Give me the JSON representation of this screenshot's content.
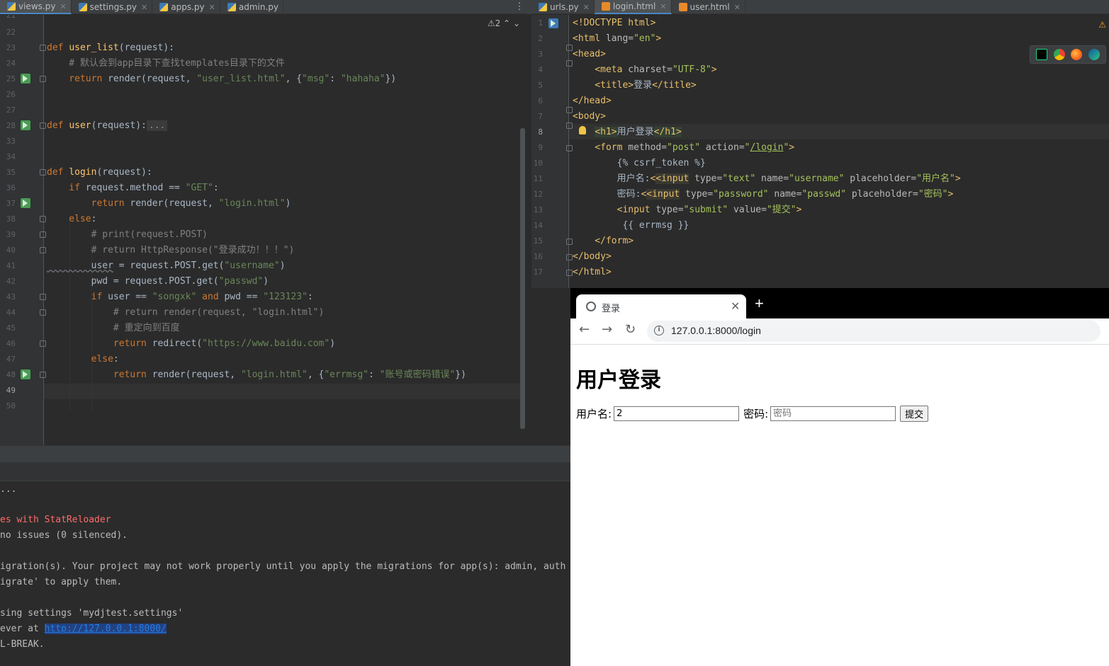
{
  "left_tabs": [
    {
      "label": "views.py",
      "active": true
    },
    {
      "label": "settings.py"
    },
    {
      "label": "apps.py"
    },
    {
      "label": "admin.py"
    }
  ],
  "right_tabs": [
    {
      "label": "urls.py"
    },
    {
      "label": "login.html",
      "active": true
    },
    {
      "label": "user.html"
    }
  ],
  "left_editor": {
    "warning_count": "2",
    "line_numbers": [
      "21",
      "22",
      "23",
      "24",
      "25",
      "26",
      "27",
      "28",
      "33",
      "34",
      "35",
      "36",
      "37",
      "38",
      "39",
      "40",
      "41",
      "42",
      "43",
      "44",
      "45",
      "46",
      "47",
      "48",
      "49",
      "50"
    ],
    "code": {
      "l23_def": "def ",
      "l23_fn": "user_list",
      "l23_rest": "(request):",
      "l24": "    # 默认会到app目录下查找templates目录下的文件",
      "l25_kw": "    return ",
      "l25_a": "render(request, ",
      "l25_s1": "\"user_list.html\"",
      "l25_b": ", {",
      "l25_s2": "\"msg\"",
      "l25_c": ": ",
      "l25_s3": "\"hahaha\"",
      "l25_d": "})",
      "l28_def": "def ",
      "l28_fn": "user",
      "l28_rest": "(request):",
      "l28_dots": "...",
      "l35_def": "def ",
      "l35_fn": "login",
      "l35_rest": "(request):",
      "l36_kw": "    if ",
      "l36_a": "request.method == ",
      "l36_s": "\"GET\"",
      "l36_b": ":",
      "l37_kw": "        return ",
      "l37_a": "render(request, ",
      "l37_s": "\"login.html\"",
      "l37_b": ")",
      "l38_kw": "    else",
      "l38_b": ":",
      "l39": "        # print(request.POST)",
      "l40": "        # return HttpResponse(\"登录成功！！！\")",
      "l41_a": "        user",
      "l41_b": " = request.POST.get(",
      "l41_s": "\"username\"",
      "l41_c": ")",
      "l42_a": "        pwd = request.POST.get(",
      "l42_s": "\"passwd\"",
      "l42_c": ")",
      "l43_kw": "        if ",
      "l43_a": "user == ",
      "l43_s1": "\"songxk\"",
      "l43_kw2": " and ",
      "l43_b": "pwd == ",
      "l43_s2": "\"123123\"",
      "l43_c": ":",
      "l44": "            # return render(request, \"login.html\")",
      "l45": "            # 重定向到百度",
      "l46_kw": "            return ",
      "l46_a": "redirect(",
      "l46_s": "\"https://www.baidu.com\"",
      "l46_b": ")",
      "l47_kw": "        else",
      "l47_b": ":",
      "l48_kw": "            return ",
      "l48_a": "render(request, ",
      "l48_s1": "\"login.html\"",
      "l48_b": ", {",
      "l48_s2": "\"errmsg\"",
      "l48_c": ": ",
      "l48_s3": "\"账号或密码错误\"",
      "l48_d": "})"
    }
  },
  "right_editor": {
    "line_numbers": [
      "1",
      "2",
      "3",
      "4",
      "5",
      "6",
      "7",
      "8",
      "9",
      "10",
      "11",
      "12",
      "13",
      "14",
      "15",
      "16",
      "17"
    ],
    "code": {
      "r1": "<!DOCTYPE html>",
      "r2_t": "<html ",
      "r2_a": "lang=",
      "r2_v": "\"en\"",
      "r2_e": ">",
      "r3": "<head>",
      "r4_t": "    <meta ",
      "r4_a": "charset=",
      "r4_v": "\"UTF-8\"",
      "r4_e": ">",
      "r5_t": "    <title>",
      "r5_x": "登录",
      "r5_e": "</title>",
      "r6": "</head>",
      "r7": "<body>",
      "r8_t": "<h1>",
      "r8_x": "用户登录",
      "r8_e": "</h1>",
      "r9_t": "    <form ",
      "r9_a1": "method=",
      "r9_v1": "\"post\" ",
      "r9_a2": "action=",
      "r9_v2q": "\"",
      "r9_v2": "/login",
      "r9_v2e": "\"",
      "r9_e": ">",
      "r10": "        {% csrf_token %}",
      "r11_x": "        用户名:",
      "r11_t": "<input",
      "r11_a1": " type=",
      "r11_v1": "\"text\"",
      "r11_a2": " name=",
      "r11_v2": "\"username\"",
      "r11_a3": " placeholder=",
      "r11_v3": "\"用户名\"",
      "r11_e": ">",
      "r12_x": "        密码:",
      "r12_t": "<input",
      "r12_a1": " type=",
      "r12_v1": "\"password\"",
      "r12_a2": " name=",
      "r12_v2": "\"passwd\"",
      "r12_a3": " placeholder=",
      "r12_v3": "\"密码\"",
      "r12_e": ">",
      "r13_t": "        <input ",
      "r13_a1": "type=",
      "r13_v1": "\"submit\" ",
      "r13_a2": "value=",
      "r13_v2": "\"提交\"",
      "r13_e": ">",
      "r14": "         {{ errmsg }}",
      "r15": "    </form>",
      "r16": "</body>",
      "r17": "</html>"
    }
  },
  "console": {
    "lines": [
      "...",
      "",
      "es with StatReloader",
      "no issues (0 silenced).",
      "",
      "igration(s). Your project may not work properly until you apply the migrations for app(s): admin, auth",
      "igrate' to apply them.",
      "",
      "sing settings 'mydjtest.settings'",
      "ever at ",
      "L-BREAK."
    ],
    "link": "http://127.0.0.1:8000/"
  },
  "browser": {
    "tab_title": "登录",
    "new_tab": "+",
    "url": "127.0.0.1:8000/login",
    "page": {
      "heading": "用户登录",
      "username_label": "用户名:",
      "username_value": "2",
      "username_placeholder": "用户名",
      "password_label": "密码:",
      "password_placeholder": "密码",
      "submit_label": "提交"
    }
  },
  "colors": {
    "ide_bg": "#2b2b2b",
    "keyword": "#cc7832",
    "function": "#ffc66d",
    "string": "#6a8759",
    "tag": "#e8bf6a"
  }
}
